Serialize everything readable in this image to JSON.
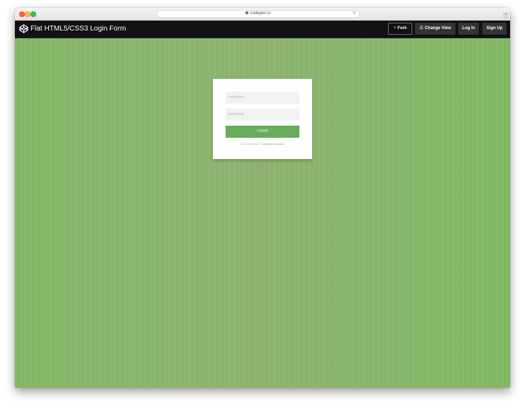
{
  "browser": {
    "url": "codepen.io",
    "reload_icon": "reload-icon",
    "lock_icon": "lock-icon"
  },
  "header": {
    "logo_icon": "codepen-logo-icon",
    "title": "Flat HTML5/CSS3 Login Form",
    "fork_icon": "⑂",
    "fork_label": "Fork",
    "change_view_icon": "☰",
    "change_view_label": "Change View",
    "login_label": "Log In",
    "signup_label": "Sign Up"
  },
  "form": {
    "username_placeholder": "username",
    "password_placeholder": "password",
    "login_label": "login",
    "register_prompt": "Not registered?",
    "register_link": "Create an account"
  },
  "colors": {
    "background": "#8ab66c",
    "accent": "#67ad5b",
    "header": "#111111"
  }
}
